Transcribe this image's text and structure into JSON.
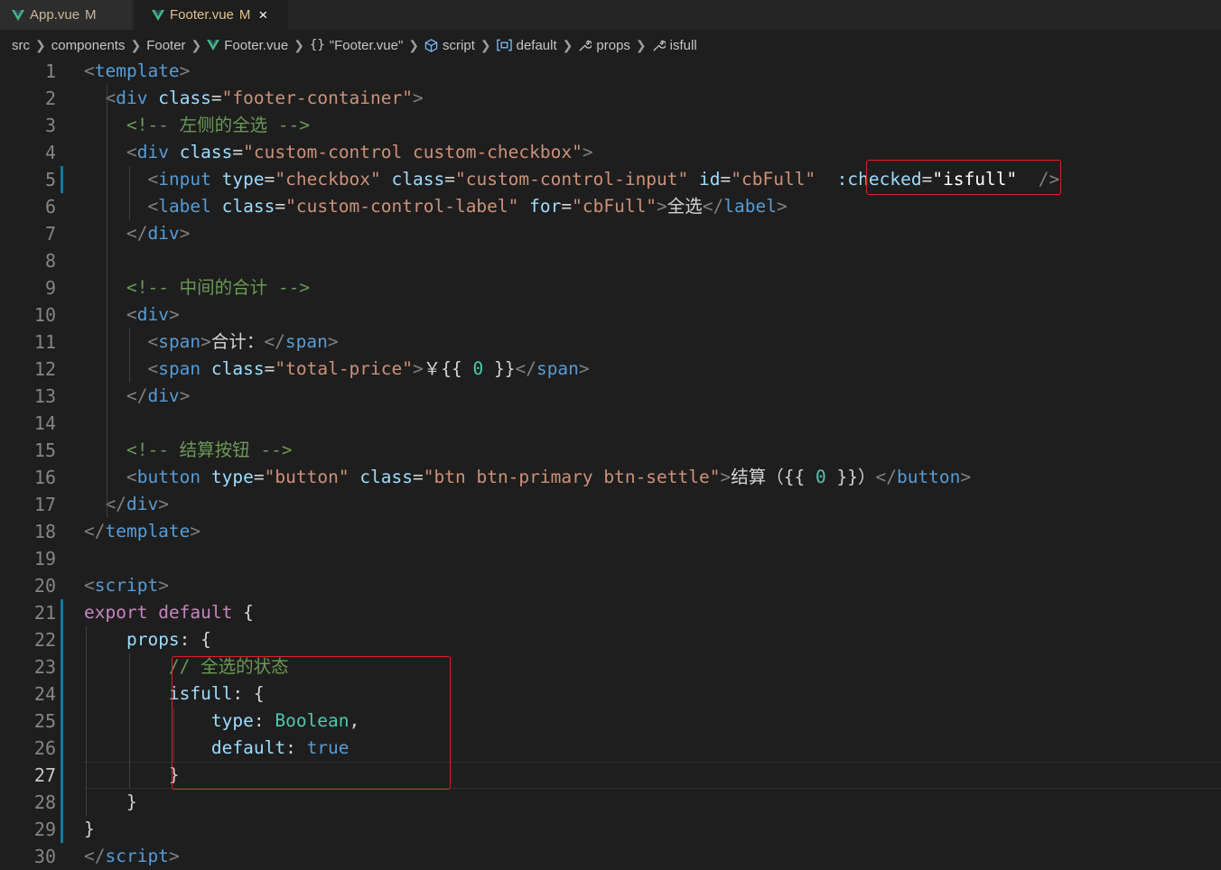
{
  "tabs": [
    {
      "label": "App.vue",
      "status": "M",
      "active": false
    },
    {
      "label": "Footer.vue",
      "status": "M",
      "active": true,
      "close": "×"
    }
  ],
  "breadcrumbs": [
    {
      "label": "src",
      "icon": ""
    },
    {
      "label": "components",
      "icon": ""
    },
    {
      "label": "Footer",
      "icon": ""
    },
    {
      "label": "Footer.vue",
      "icon": "vue-icon"
    },
    {
      "label": "\"Footer.vue\"",
      "icon": "braces-icon"
    },
    {
      "label": "script",
      "icon": "cube-icon"
    },
    {
      "label": "default",
      "icon": "module-icon"
    },
    {
      "label": "props",
      "icon": "wrench-icon"
    },
    {
      "label": "isfull",
      "icon": "wrench-icon"
    }
  ],
  "colors": {
    "background": "#1e1e1e",
    "tag": "#569cd6",
    "attr": "#9cdcfe",
    "string": "#ce9178",
    "comment": "#6a9955",
    "keyword": "#c586c0",
    "highlight_box": "#e02020"
  },
  "editor": {
    "current_line": 27,
    "lines": [
      {
        "n": "1",
        "tokens": [
          [
            "p",
            "<"
          ],
          [
            "t",
            "template"
          ],
          [
            "p",
            ">"
          ]
        ]
      },
      {
        "n": "2",
        "tokens": [
          [
            "l",
            "  "
          ],
          [
            "p",
            "<"
          ],
          [
            "t",
            "div"
          ],
          [
            "l",
            " "
          ],
          [
            "a",
            "class"
          ],
          [
            "l",
            "="
          ],
          [
            "s",
            "\"footer-container\""
          ],
          [
            "p",
            ">"
          ]
        ]
      },
      {
        "n": "3",
        "tokens": [
          [
            "l",
            "    "
          ],
          [
            "c",
            "<!-- 左侧的全选 -->"
          ]
        ]
      },
      {
        "n": "4",
        "tokens": [
          [
            "l",
            "    "
          ],
          [
            "p",
            "<"
          ],
          [
            "t",
            "div"
          ],
          [
            "l",
            " "
          ],
          [
            "a",
            "class"
          ],
          [
            "l",
            "="
          ],
          [
            "s",
            "\"custom-control custom-checkbox\""
          ],
          [
            "p",
            ">"
          ]
        ]
      },
      {
        "n": "5",
        "tokens": [
          [
            "l",
            "      "
          ],
          [
            "p",
            "<"
          ],
          [
            "t",
            "input"
          ],
          [
            "l",
            " "
          ],
          [
            "a",
            "type"
          ],
          [
            "l",
            "="
          ],
          [
            "s",
            "\"checkbox\""
          ],
          [
            "l",
            " "
          ],
          [
            "a",
            "class"
          ],
          [
            "l",
            "="
          ],
          [
            "s",
            "\"custom-control-input\""
          ],
          [
            "l",
            " "
          ],
          [
            "a",
            "id"
          ],
          [
            "l",
            "="
          ],
          [
            "s",
            "\"cbFull\""
          ],
          [
            "l",
            "  "
          ],
          [
            "a",
            ":checked"
          ],
          [
            "l",
            "="
          ],
          [
            "w",
            "\"isfull\""
          ],
          [
            "l",
            "  "
          ],
          [
            "p",
            "/>"
          ]
        ]
      },
      {
        "n": "6",
        "tokens": [
          [
            "l",
            "      "
          ],
          [
            "p",
            "<"
          ],
          [
            "t",
            "label"
          ],
          [
            "l",
            " "
          ],
          [
            "a",
            "class"
          ],
          [
            "l",
            "="
          ],
          [
            "s",
            "\"custom-control-label\""
          ],
          [
            "l",
            " "
          ],
          [
            "a",
            "for"
          ],
          [
            "l",
            "="
          ],
          [
            "s",
            "\"cbFull\""
          ],
          [
            "p",
            ">"
          ],
          [
            "l",
            "全选"
          ],
          [
            "p",
            "</"
          ],
          [
            "t",
            "label"
          ],
          [
            "p",
            ">"
          ]
        ]
      },
      {
        "n": "7",
        "tokens": [
          [
            "l",
            "    "
          ],
          [
            "p",
            "</"
          ],
          [
            "t",
            "div"
          ],
          [
            "p",
            ">"
          ]
        ]
      },
      {
        "n": "8",
        "tokens": []
      },
      {
        "n": "9",
        "tokens": [
          [
            "l",
            "    "
          ],
          [
            "c",
            "<!-- 中间的合计 -->"
          ]
        ]
      },
      {
        "n": "10",
        "tokens": [
          [
            "l",
            "    "
          ],
          [
            "p",
            "<"
          ],
          [
            "t",
            "div"
          ],
          [
            "p",
            ">"
          ]
        ]
      },
      {
        "n": "11",
        "tokens": [
          [
            "l",
            "      "
          ],
          [
            "p",
            "<"
          ],
          [
            "t",
            "span"
          ],
          [
            "p",
            ">"
          ],
          [
            "l",
            "合计："
          ],
          [
            "p",
            "</"
          ],
          [
            "t",
            "span"
          ],
          [
            "p",
            ">"
          ]
        ]
      },
      {
        "n": "12",
        "tokens": [
          [
            "l",
            "      "
          ],
          [
            "p",
            "<"
          ],
          [
            "t",
            "span"
          ],
          [
            "l",
            " "
          ],
          [
            "a",
            "class"
          ],
          [
            "l",
            "="
          ],
          [
            "s",
            "\"total-price\""
          ],
          [
            "p",
            ">"
          ],
          [
            "l",
            "￥{{ "
          ],
          [
            "ty",
            "0"
          ],
          [
            "l",
            " }}"
          ],
          [
            "p",
            "</"
          ],
          [
            "t",
            "span"
          ],
          [
            "p",
            ">"
          ]
        ]
      },
      {
        "n": "13",
        "tokens": [
          [
            "l",
            "    "
          ],
          [
            "p",
            "</"
          ],
          [
            "t",
            "div"
          ],
          [
            "p",
            ">"
          ]
        ]
      },
      {
        "n": "14",
        "tokens": []
      },
      {
        "n": "15",
        "tokens": [
          [
            "l",
            "    "
          ],
          [
            "c",
            "<!-- 结算按钮 -->"
          ]
        ]
      },
      {
        "n": "16",
        "tokens": [
          [
            "l",
            "    "
          ],
          [
            "p",
            "<"
          ],
          [
            "t",
            "button"
          ],
          [
            "l",
            " "
          ],
          [
            "a",
            "type"
          ],
          [
            "l",
            "="
          ],
          [
            "s",
            "\"button\""
          ],
          [
            "l",
            " "
          ],
          [
            "a",
            "class"
          ],
          [
            "l",
            "="
          ],
          [
            "s",
            "\"btn btn-primary btn-settle\""
          ],
          [
            "p",
            ">"
          ],
          [
            "l",
            "结算（{{ "
          ],
          [
            "ty",
            "0"
          ],
          [
            "l",
            " }}）"
          ],
          [
            "p",
            "</"
          ],
          [
            "t",
            "button"
          ],
          [
            "p",
            ">"
          ]
        ]
      },
      {
        "n": "17",
        "tokens": [
          [
            "l",
            "  "
          ],
          [
            "p",
            "</"
          ],
          [
            "t",
            "div"
          ],
          [
            "p",
            ">"
          ]
        ]
      },
      {
        "n": "18",
        "tokens": [
          [
            "p",
            "</"
          ],
          [
            "t",
            "template"
          ],
          [
            "p",
            ">"
          ]
        ]
      },
      {
        "n": "19",
        "tokens": []
      },
      {
        "n": "20",
        "tokens": [
          [
            "p",
            "<"
          ],
          [
            "t",
            "script"
          ],
          [
            "p",
            ">"
          ]
        ]
      },
      {
        "n": "21",
        "tokens": [
          [
            "k",
            "export"
          ],
          [
            "l",
            " "
          ],
          [
            "k",
            "default"
          ],
          [
            "l",
            " {"
          ]
        ]
      },
      {
        "n": "22",
        "tokens": [
          [
            "l",
            "    "
          ],
          [
            "a",
            "props"
          ],
          [
            "l",
            ": {"
          ]
        ]
      },
      {
        "n": "23",
        "tokens": [
          [
            "l",
            "        "
          ],
          [
            "c",
            "// 全选的状态"
          ]
        ]
      },
      {
        "n": "24",
        "tokens": [
          [
            "l",
            "        "
          ],
          [
            "a",
            "isfull"
          ],
          [
            "l",
            ": {"
          ]
        ]
      },
      {
        "n": "25",
        "tokens": [
          [
            "l",
            "            "
          ],
          [
            "a",
            "type"
          ],
          [
            "l",
            ": "
          ],
          [
            "ty",
            "Boolean"
          ],
          [
            "l",
            ","
          ]
        ]
      },
      {
        "n": "26",
        "tokens": [
          [
            "l",
            "            "
          ],
          [
            "a",
            "default"
          ],
          [
            "l",
            ": "
          ],
          [
            "b",
            "true"
          ]
        ]
      },
      {
        "n": "27",
        "tokens": [
          [
            "l",
            "        }"
          ]
        ]
      },
      {
        "n": "28",
        "tokens": [
          [
            "l",
            "    }"
          ]
        ]
      },
      {
        "n": "29",
        "tokens": [
          [
            "l",
            "}"
          ]
        ]
      },
      {
        "n": "30",
        "tokens": [
          [
            "p",
            "</"
          ],
          [
            "t",
            "script"
          ],
          [
            "p",
            ">"
          ]
        ]
      }
    ]
  }
}
